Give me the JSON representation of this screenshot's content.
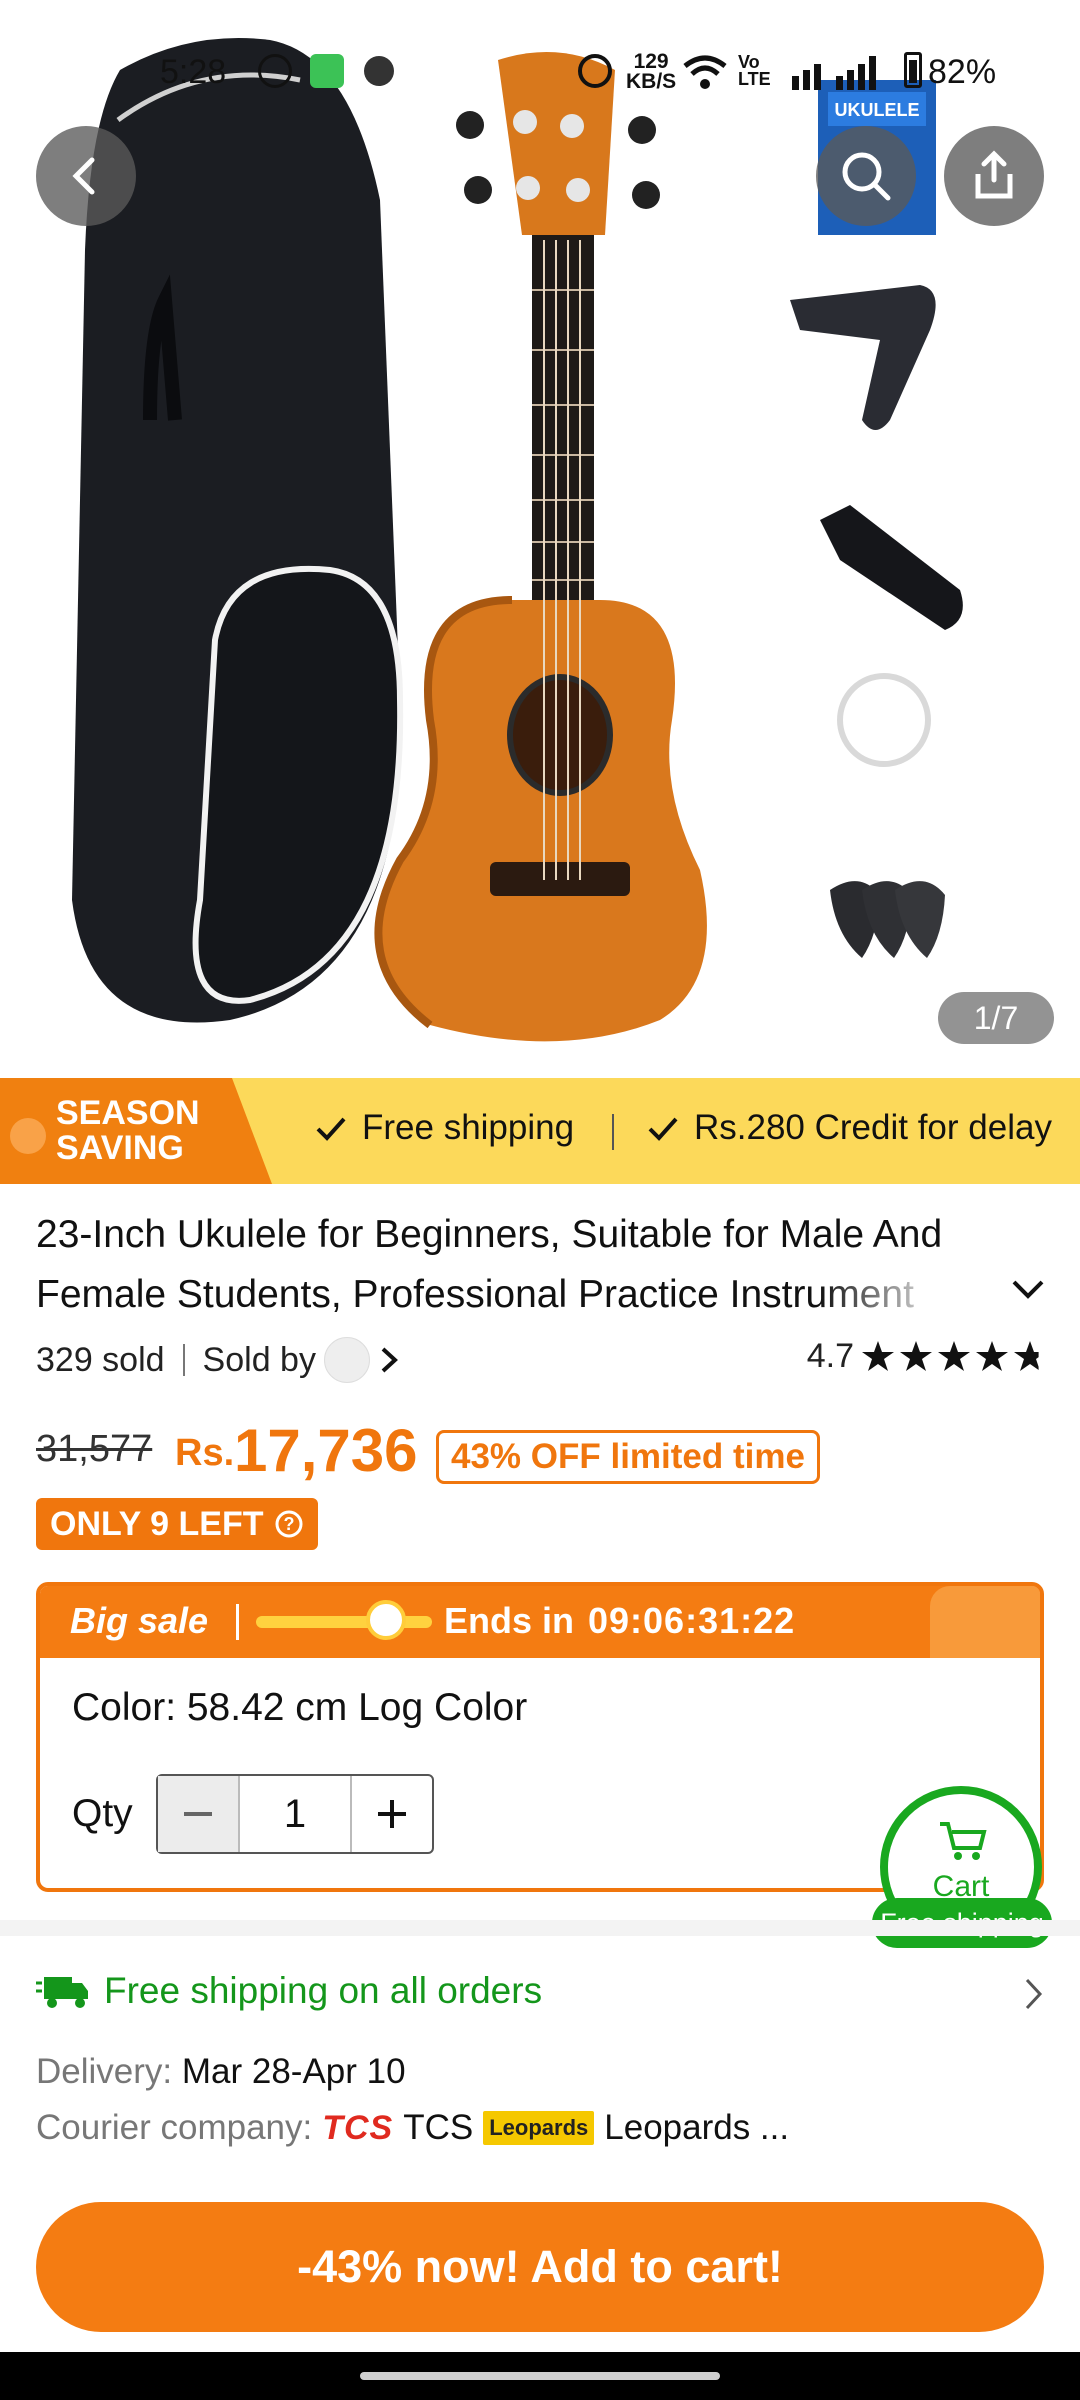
{
  "status_bar": {
    "time": "5:28",
    "net_speed_top": "129",
    "net_speed_unit": "KB/S",
    "volte_top": "Vo",
    "volte_bottom": "LTE",
    "battery": "82%"
  },
  "gallery": {
    "counter": "1/7",
    "thumbnail_book_text": "UKULELE"
  },
  "promo_banner": {
    "tag_line1": "SEASON",
    "tag_line2": "SAVING",
    "item1": "Free shipping",
    "item2": "Rs.280 Credit for delay"
  },
  "product": {
    "title": "23-Inch Ukulele for Beginners, Suitable for Male And Female Students, Professional Practice Instrument",
    "sold": "329 sold",
    "sold_by_label": "Sold by",
    "rating": "4.7",
    "stars": 4.7
  },
  "pricing": {
    "original": "31,577",
    "currency": "Rs.",
    "current": "17,736",
    "discount_badge": "43% OFF limited time",
    "stock_badge": "ONLY 9 LEFT"
  },
  "big_sale": {
    "label": "Big sale",
    "ends_label": "Ends in",
    "timer": "09:06:31:22",
    "color_line": "Color: 58.42 cm Log Color",
    "qty_label": "Qty",
    "qty_value": "1"
  },
  "cart_float": {
    "label": "Cart",
    "pill": "Free shipping"
  },
  "shipping": {
    "headline": "Free shipping on all orders",
    "delivery_label": "Delivery:",
    "delivery_value": "Mar 28-Apr 10",
    "courier_label": "Courier company:",
    "courier1_logo": "TCS",
    "courier1": "TCS",
    "courier2_logo": "Leopards",
    "courier2": "Leopards ..."
  },
  "cta": {
    "add_to_cart": "-43% now! Add to cart!"
  },
  "colors": {
    "accent_orange": "#f47c12",
    "promo_yellow": "#fcd95a",
    "green": "#19a81f"
  }
}
